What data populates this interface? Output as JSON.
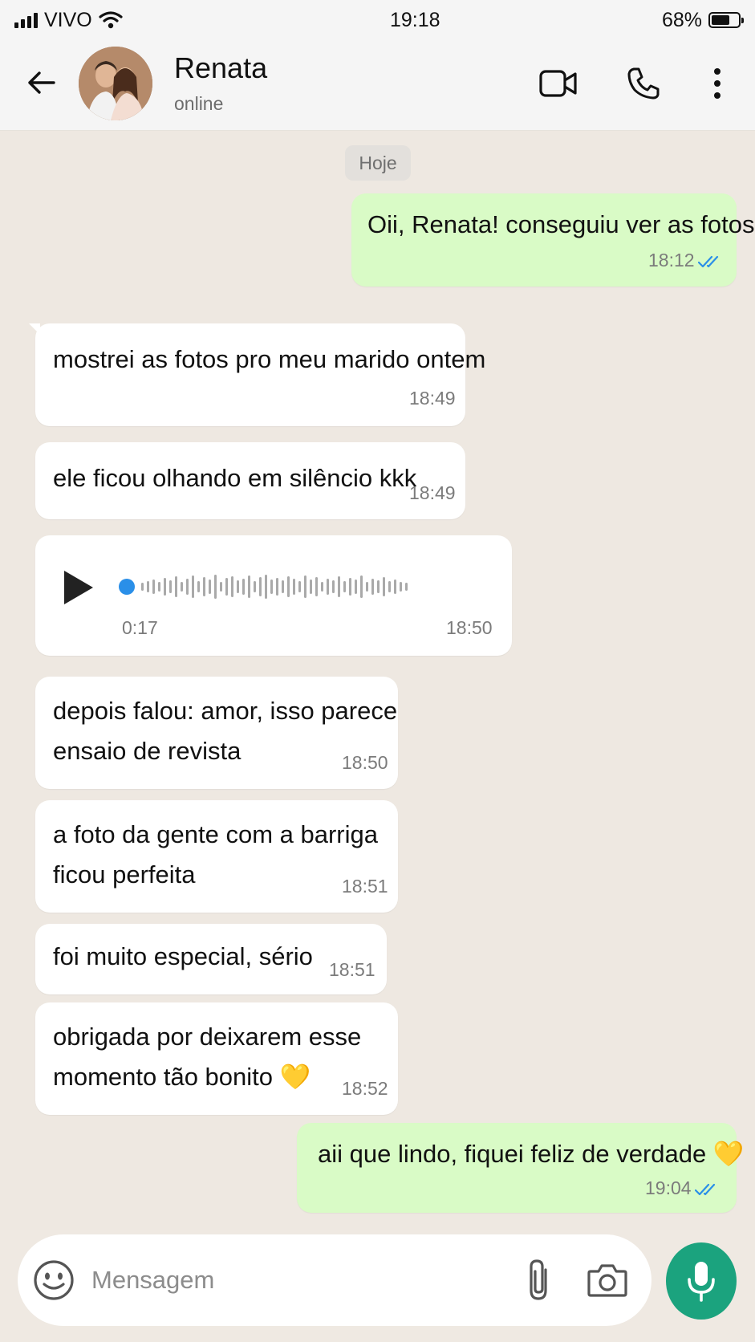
{
  "status_bar": {
    "carrier": "VIVO",
    "time": "19:18",
    "battery": "68%",
    "battery_level": 0.68
  },
  "header": {
    "contact_name": "Renata",
    "contact_status": "online"
  },
  "chat": {
    "date_chip": "Hoje",
    "messages": [
      {
        "direction": "out",
        "lines": [
          "Oii, Renata! conseguiu ver as fotos?"
        ],
        "time": "18:12",
        "read": true
      },
      {
        "direction": "in",
        "lines": [
          "mostrei as fotos pro meu marido ontem"
        ],
        "time": "18:49"
      },
      {
        "direction": "in",
        "lines": [
          "ele ficou olhando em silêncio kkk"
        ],
        "time": "18:49"
      },
      {
        "direction": "in",
        "type": "voice",
        "duration": "0:17",
        "time": "18:50"
      },
      {
        "direction": "in",
        "lines": [
          "depois falou: amor, isso parece",
          "ensaio de revista"
        ],
        "time": "18:50"
      },
      {
        "direction": "in",
        "lines": [
          "a foto da gente com a barriga",
          "ficou perfeita"
        ],
        "time": "18:51"
      },
      {
        "direction": "in",
        "lines": [
          "foi muito especial, sério"
        ],
        "time": "18:51"
      },
      {
        "direction": "in",
        "lines": [
          "obrigada por deixarem esse",
          "momento tão bonito 💛"
        ],
        "time": "18:52"
      },
      {
        "direction": "out",
        "lines": [
          "aii que lindo, fiquei feliz de verdade 💛"
        ],
        "time": "19:04",
        "read": true
      }
    ]
  },
  "composer": {
    "placeholder": "Mensagem",
    "value": ""
  },
  "colors": {
    "outgoing_bubble": "#d9fbc6",
    "incoming_bubble": "#ffffff",
    "read_ticks": "#2a8fe8",
    "mic_button": "#1ba37e",
    "chat_background": "#eee8e1"
  },
  "icons": {
    "back": "arrow-left-icon",
    "video": "video-camera-icon",
    "call": "phone-icon",
    "menu": "more-vertical-icon",
    "play": "play-icon",
    "emoji": "smiley-icon",
    "attach": "paperclip-icon",
    "camera": "camera-icon",
    "mic": "microphone-icon",
    "read": "double-check-icon"
  }
}
